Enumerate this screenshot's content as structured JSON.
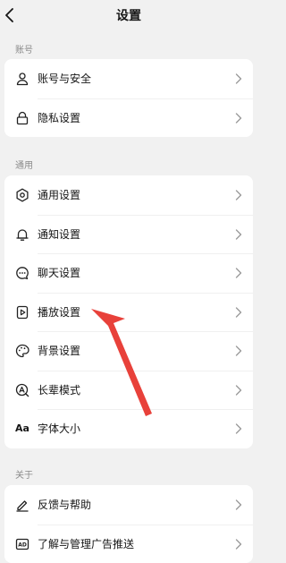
{
  "header": {
    "title": "设置"
  },
  "sections": [
    {
      "label": "账号",
      "items": [
        {
          "label": "账号与安全",
          "icon": "user-icon"
        },
        {
          "label": "隐私设置",
          "icon": "lock-icon"
        }
      ]
    },
    {
      "label": "通用",
      "items": [
        {
          "label": "通用设置",
          "icon": "gear-icon"
        },
        {
          "label": "通知设置",
          "icon": "bell-icon"
        },
        {
          "label": "聊天设置",
          "icon": "chat-icon"
        },
        {
          "label": "播放设置",
          "icon": "play-icon"
        },
        {
          "label": "背景设置",
          "icon": "palette-icon"
        },
        {
          "label": "长辈模式",
          "icon": "elder-mode-icon"
        },
        {
          "label": "字体大小",
          "icon": "font-size-icon",
          "glyph": "Aa"
        }
      ]
    },
    {
      "label": "关于",
      "items": [
        {
          "label": "反馈与帮助",
          "icon": "feedback-icon"
        },
        {
          "label": "了解与管理广告推送",
          "icon": "ad-icon",
          "glyph": "AD"
        }
      ]
    }
  ],
  "annotation": {
    "icon": "red-pointer-arrow",
    "color": "#e8413a"
  }
}
